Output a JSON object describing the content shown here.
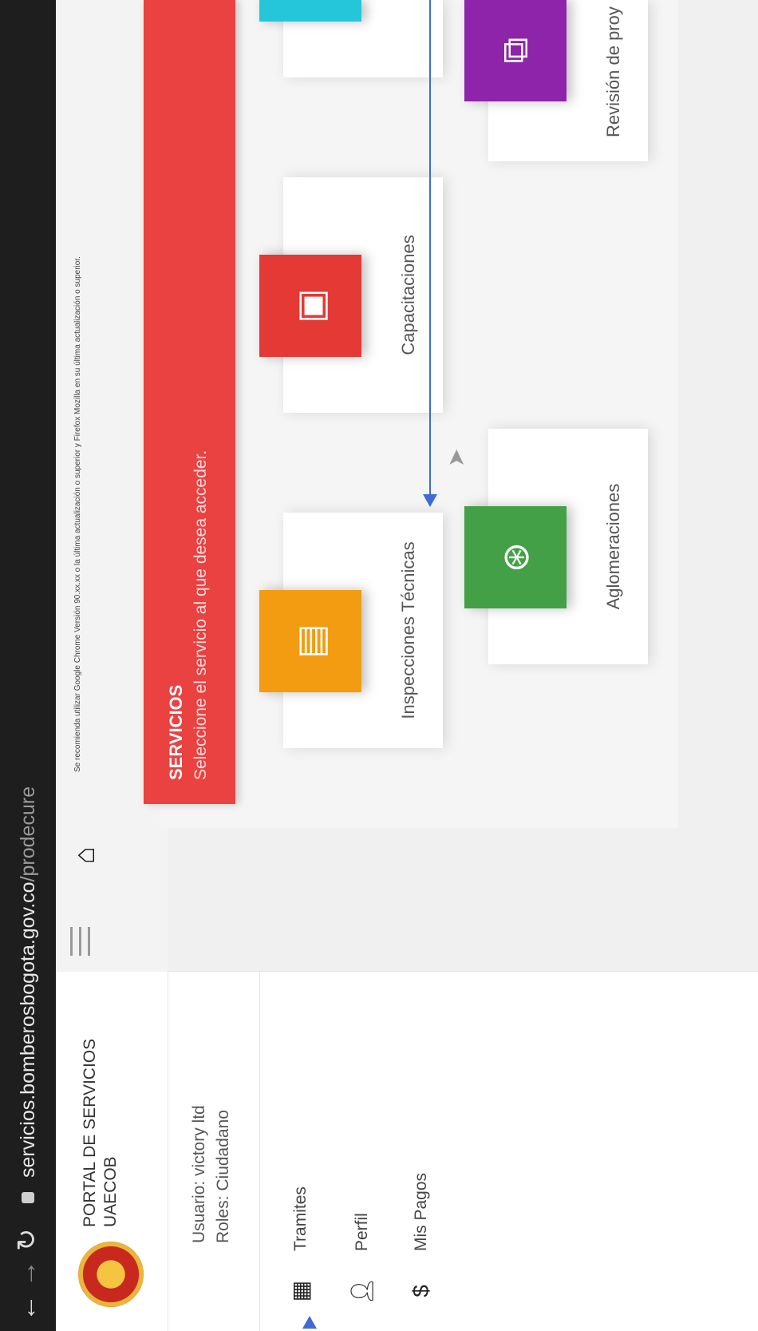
{
  "browser": {
    "url_domain": "servicios.bomberosbogota.gov.co",
    "url_path": "/prodecure"
  },
  "sidebar": {
    "brand": "PORTAL DE SERVICIOS UAECOB",
    "user_line": "Usuario: victory ltd",
    "roles_line": "Roles: Ciudadano",
    "items": [
      {
        "label": "Tramites",
        "icon": "grid-icon"
      },
      {
        "label": "Perfil",
        "icon": "user-icon"
      },
      {
        "label": "Mis Pagos",
        "icon": "dollar-icon"
      }
    ]
  },
  "notice": "Se recomienda utilizar Google Chrome Versión 90.xx.xx o la última actualización o superior y Firefox Mozilla en su última actualización o superior.",
  "services_header": {
    "title": "SERVICIOS",
    "subtitle": "Seleccione el servicio al que desea acceder."
  },
  "cards": [
    {
      "label": "Inspecciones Técnicas",
      "color": "#f39c12",
      "icon": "document-icon"
    },
    {
      "label": "Capacitaciones",
      "color": "#e53935",
      "icon": "presentation-icon"
    },
    {
      "label": "Aglomeraciones",
      "color": "#43a047",
      "icon": "crowd-icon"
    },
    {
      "label": "Revisión de proy",
      "color": "#8e24aa",
      "icon": "review-icon"
    }
  ],
  "colors": {
    "header_red": "#ea4141",
    "cyan_tile": "#26c6da",
    "annotation_blue": "#3f6ad8"
  }
}
